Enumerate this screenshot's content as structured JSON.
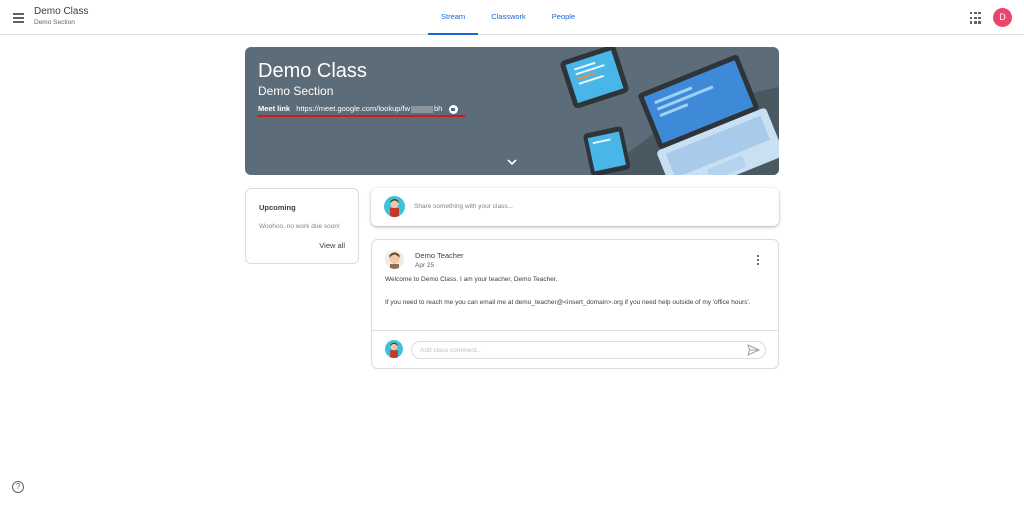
{
  "header": {
    "class_title": "Demo Class",
    "class_section": "Demo Section",
    "tabs": [
      {
        "label": "Stream",
        "active": true
      },
      {
        "label": "Classwork",
        "active": false
      },
      {
        "label": "People",
        "active": false
      }
    ],
    "avatar_letter": "D",
    "avatar_color": "#e8466a",
    "apps_icon": "google-apps-grid-icon",
    "menu_icon": "hamburger-menu-icon"
  },
  "banner": {
    "title": "Demo Class",
    "section": "Demo Section",
    "meet_label": "Meet link",
    "meet_link_start": "https://meet.google.com/lookup/fw",
    "meet_link_end": "bh",
    "background_color": "#5c6c78",
    "annotation_color": "#d11a1a"
  },
  "upcoming": {
    "title": "Upcoming",
    "empty_message": "Woohoo, no work due soon!",
    "view_all": "View all"
  },
  "share": {
    "placeholder": "Share something with your class..."
  },
  "post": {
    "author": "Demo Teacher",
    "date": "Apr 25",
    "body_line1": "Welcome to Demo Class. I am your teacher, Demo Teacher.",
    "body_line2": "If you need to reach me you can email me at demo_teacher@<insert_domain>.org if you need help outside of my 'office hours'.",
    "comment_placeholder": "Add class comment..."
  },
  "footer": {
    "help_glyph": "?"
  }
}
